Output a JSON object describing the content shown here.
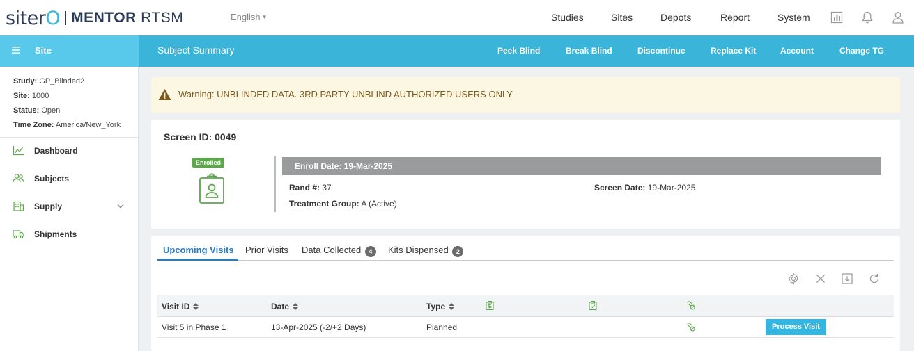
{
  "header": {
    "brand": "siterO",
    "product_bold": "MENTOR",
    "product_rest": "RTSM",
    "language": "English",
    "nav": [
      "Studies",
      "Sites",
      "Depots",
      "Report",
      "System"
    ]
  },
  "sidebar": {
    "title": "Site",
    "info": [
      {
        "label": "Study:",
        "value": "GP_Blinded2"
      },
      {
        "label": "Site:",
        "value": "1000"
      },
      {
        "label": "Status:",
        "value": "Open"
      },
      {
        "label": "Time Zone:",
        "value": "America/New_York"
      }
    ],
    "items": [
      {
        "label": "Dashboard",
        "icon": "chart-line-icon"
      },
      {
        "label": "Subjects",
        "icon": "users-icon"
      },
      {
        "label": "Supply",
        "icon": "building-icon"
      },
      {
        "label": "Shipments",
        "icon": "truck-icon"
      }
    ]
  },
  "subheader": {
    "title": "Subject Summary",
    "actions": [
      "Peek Blind",
      "Break Blind",
      "Discontinue",
      "Replace Kit",
      "Account",
      "Change TG"
    ]
  },
  "warning": {
    "text": "Warning: UNBLINDED DATA. 3RD PARTY UNBLIND AUTHORIZED USERS ONLY"
  },
  "subject": {
    "screen_id": "Screen ID: 0049",
    "status_badge": "Enrolled",
    "enroll_date": "Enroll Date: 19-Mar-2025",
    "rand_label": "Rand #:",
    "rand_value": "37",
    "screen_date_label": "Screen Date:",
    "screen_date_value": "19-Mar-2025",
    "tg_label": "Treatment Group:",
    "tg_value": "A (Active)"
  },
  "tabs": [
    {
      "label": "Upcoming Visits",
      "count": null
    },
    {
      "label": "Prior Visits",
      "count": null
    },
    {
      "label": "Data Collected",
      "count": "4"
    },
    {
      "label": "Kits Dispensed",
      "count": "2"
    }
  ],
  "table": {
    "columns": [
      "Visit ID",
      "Date",
      "Type"
    ],
    "rows": [
      {
        "visit_id": "Visit 5 in Phase 1",
        "date": "13-Apr-2025 (-2/+2 Days)",
        "type": "Planned",
        "action": "Process Visit"
      }
    ]
  },
  "colors": {
    "accent": "#3ab4d9",
    "sidebar_accent": "#58c8eb",
    "enrolled": "#5aa84a",
    "link": "#2a7bbf"
  }
}
